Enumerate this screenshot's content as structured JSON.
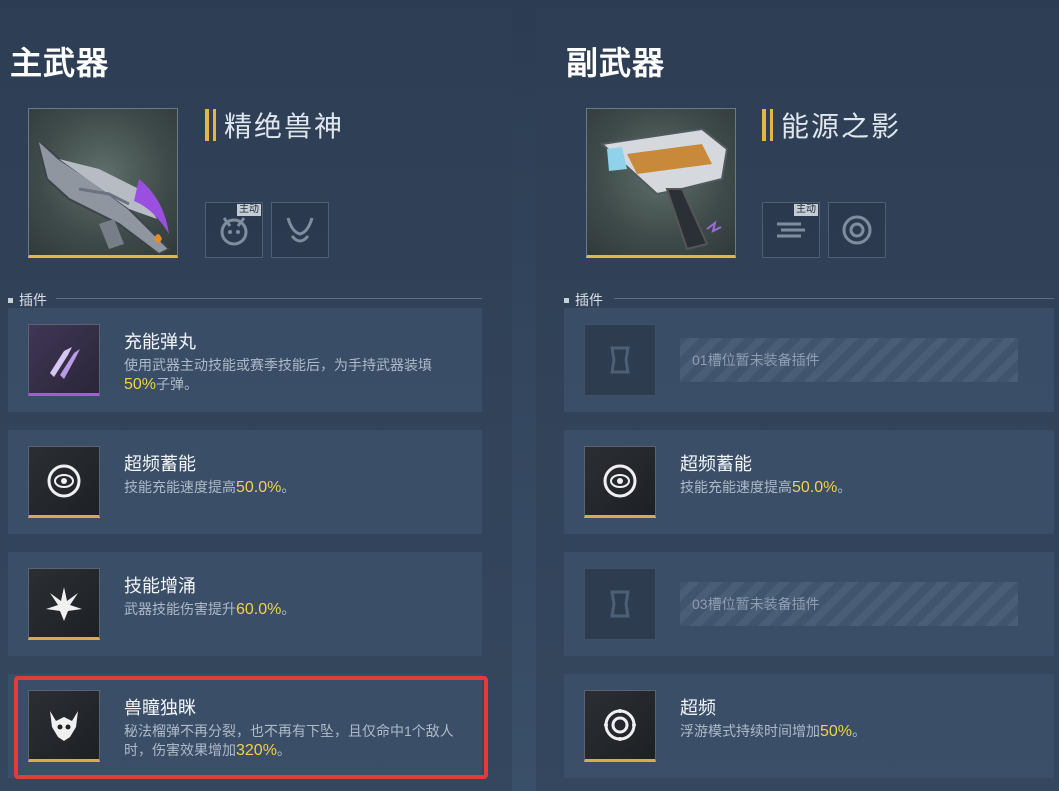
{
  "main_weapon": {
    "title": "主武器",
    "name": "精绝兽神",
    "skills": [
      {
        "icon": "beast-skull-skill-icon",
        "tag": "主动"
      },
      {
        "icon": "beast-horn-skill-icon",
        "tag": ""
      }
    ],
    "section_label": "插件",
    "plugins": [
      {
        "name": "充能弹丸",
        "desc_prefix": "使用武器主动技能或赛季技能后，为手持武器装填",
        "value": "50%",
        "desc_suffix": "子弹。",
        "rarity": "purple",
        "icon": "bullets-icon"
      },
      {
        "name": "超频蓄能",
        "desc_prefix": "技能充能速度提高",
        "value": "50.0%",
        "desc_suffix": "。",
        "rarity": "gold",
        "icon": "eye-ring-icon"
      },
      {
        "name": "技能增涌",
        "desc_prefix": "武器技能伤害提升",
        "value": "60.0%",
        "desc_suffix": "。",
        "rarity": "gold",
        "icon": "burst-icon"
      },
      {
        "name": "兽瞳独眯",
        "desc_prefix": "秘法榴弹不再分裂，也不再有下坠，且仅命中1个敌人时，伤害效果增加",
        "value": "320%",
        "desc_suffix": "。",
        "rarity": "gold",
        "icon": "beast-eye-icon"
      }
    ]
  },
  "sub_weapon": {
    "title": "副武器",
    "name": "能源之影",
    "skills": [
      {
        "icon": "energy-dash-skill-icon",
        "tag": "主动"
      },
      {
        "icon": "target-ring-skill-icon",
        "tag": ""
      }
    ],
    "section_label": "插件",
    "plugins": [
      {
        "empty": true,
        "empty_text": "01槽位暂未装备插件"
      },
      {
        "name": "超频蓄能",
        "desc_prefix": "技能充能速度提高",
        "value": "50.0%",
        "desc_suffix": "。",
        "rarity": "gold",
        "icon": "eye-ring-icon"
      },
      {
        "empty": true,
        "empty_text": "03槽位暂未装备插件"
      },
      {
        "name": "超频",
        "desc_prefix": "浮游模式持续时间增加",
        "value": "50%",
        "desc_suffix": "。",
        "rarity": "gold",
        "icon": "gear-ring-icon"
      }
    ]
  },
  "colors": {
    "accent_gold": "#e3b648",
    "highlight_red": "#e33a3a",
    "value_yellow": "#f2d04a"
  }
}
